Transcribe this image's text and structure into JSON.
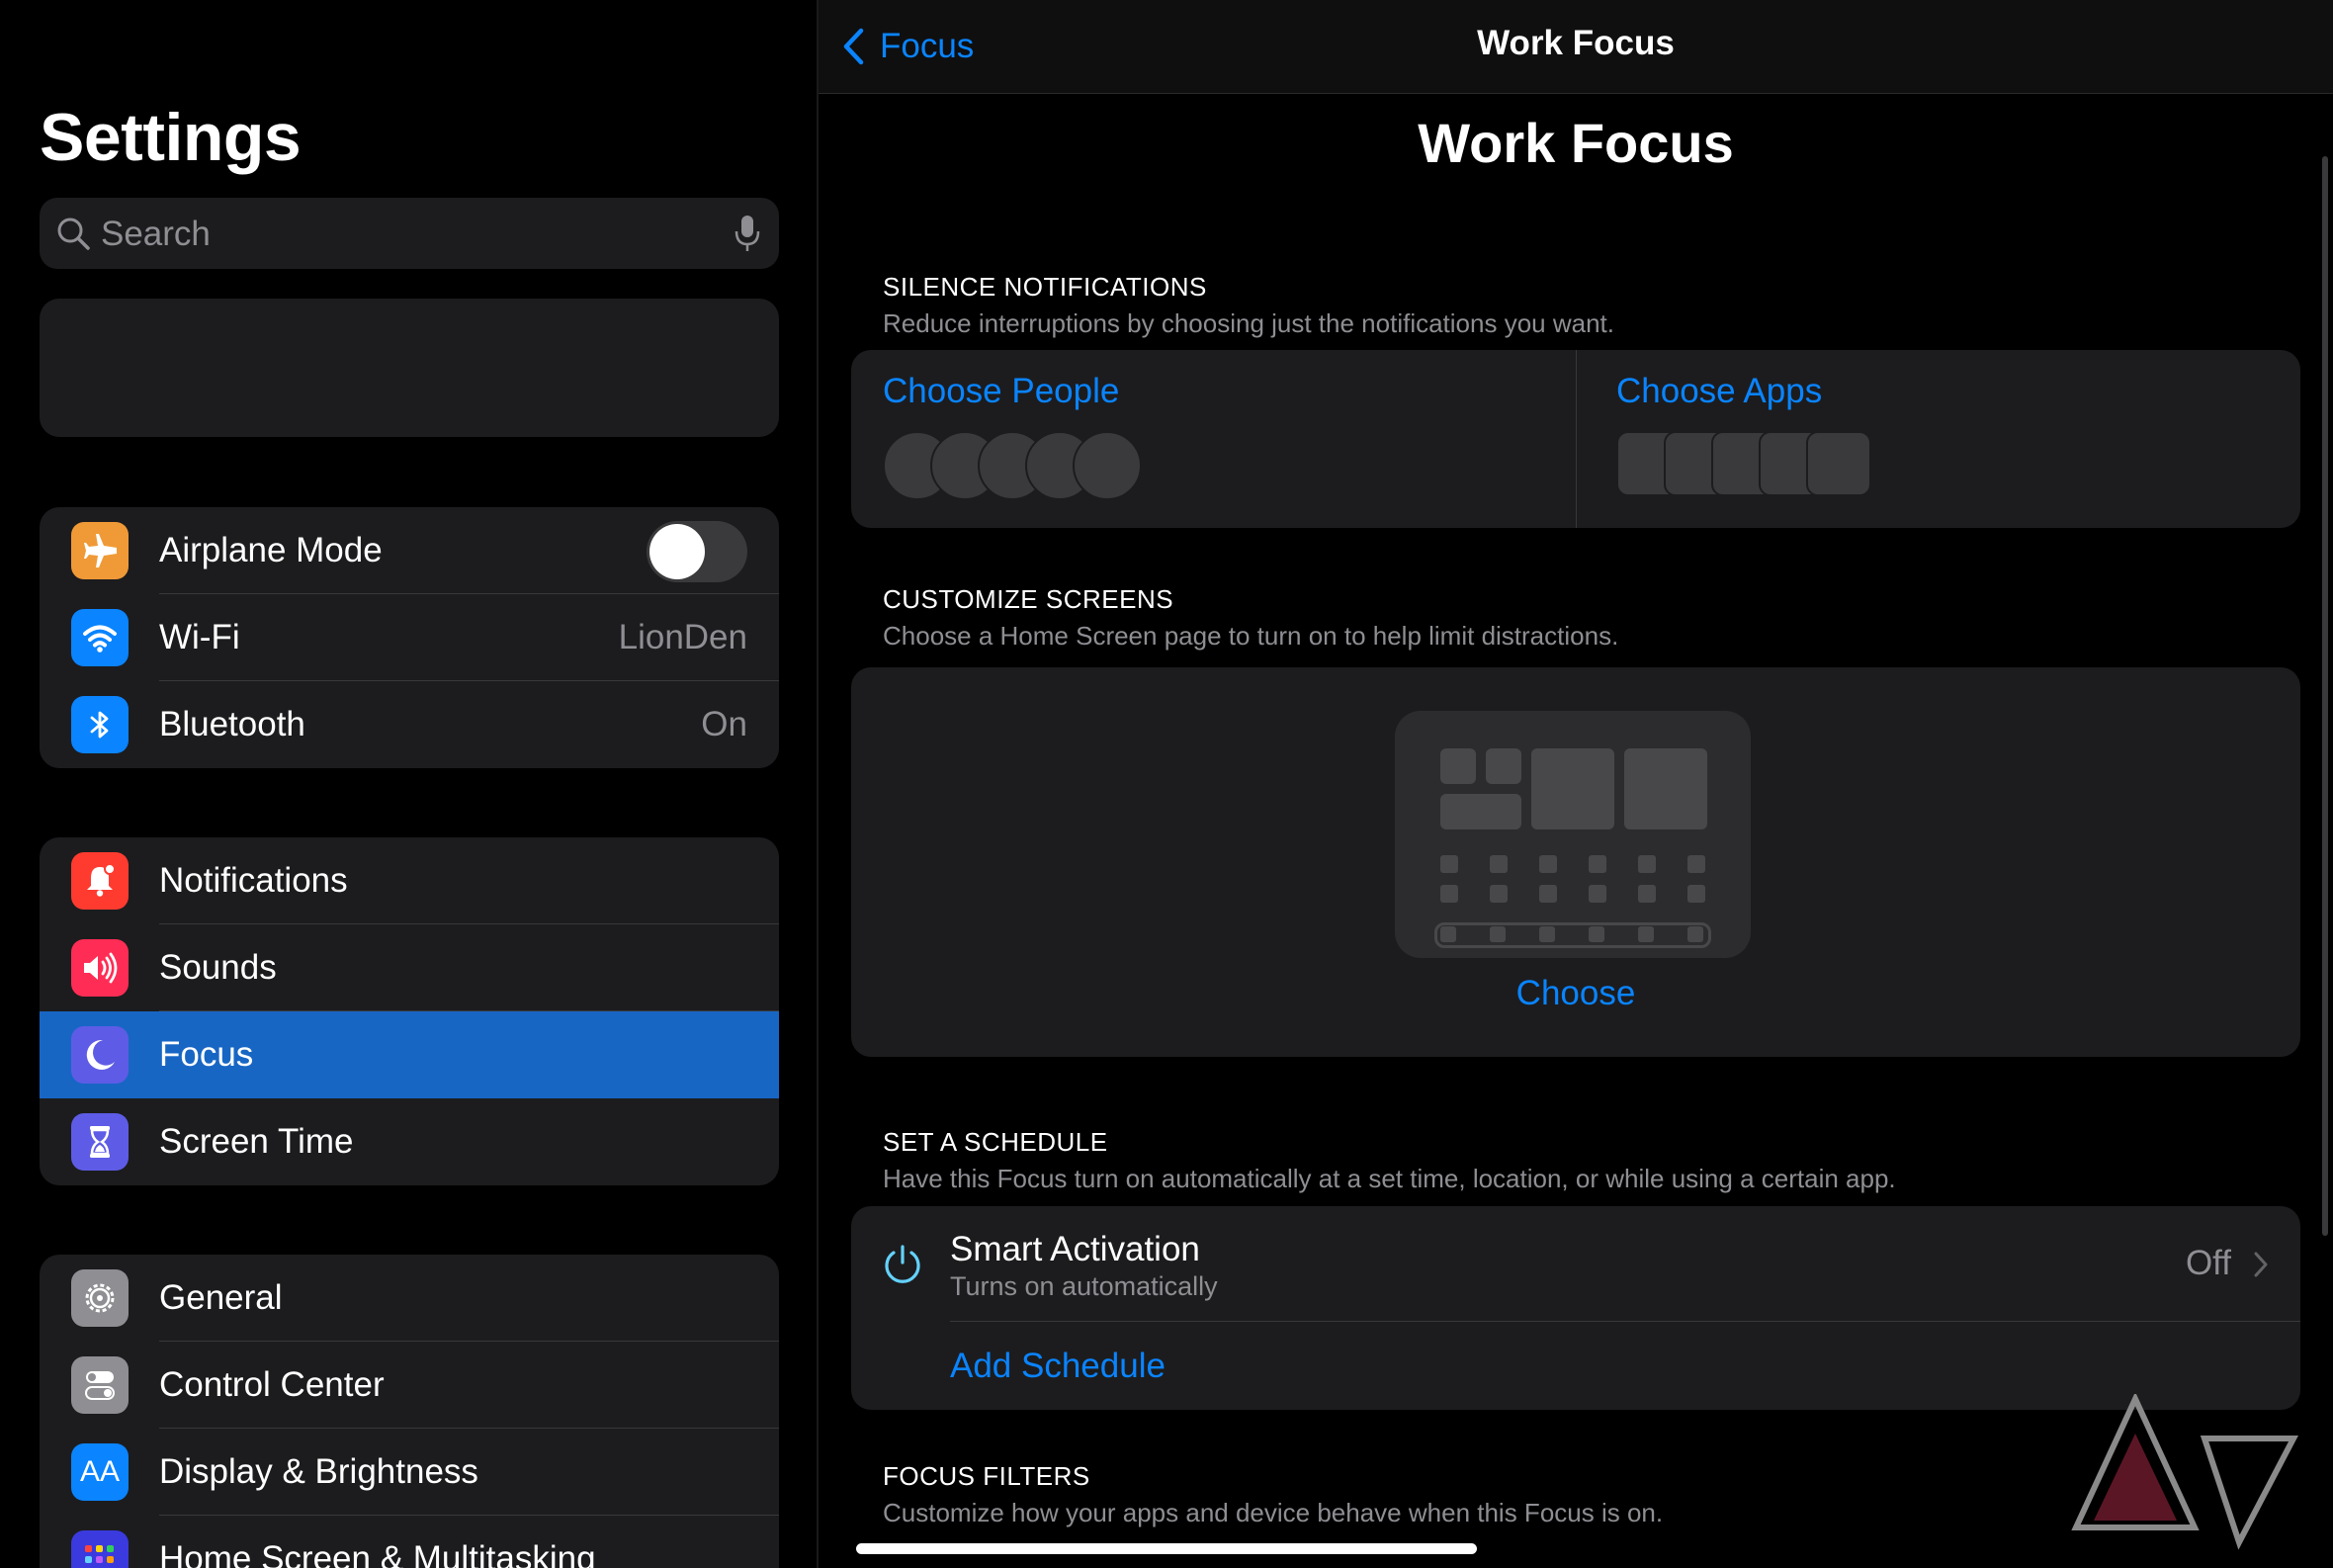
{
  "sidebar": {
    "title": "Settings",
    "search": {
      "placeholder": "Search",
      "icon": "magnifier-icon",
      "mic_icon": "mic-icon"
    },
    "groups": [
      {
        "items": [
          {
            "label": "Airplane Mode",
            "icon": "airplane-icon",
            "icon_color": "#f09a37",
            "toggle": false
          },
          {
            "label": "Wi-Fi",
            "icon": "wifi-icon",
            "icon_color": "#0a84ff",
            "value": "LionDen"
          },
          {
            "label": "Bluetooth",
            "icon": "bluetooth-icon",
            "icon_color": "#0a84ff",
            "value": "On"
          }
        ]
      },
      {
        "items": [
          {
            "label": "Notifications",
            "icon": "bell-icon",
            "icon_color": "#ff3b30"
          },
          {
            "label": "Sounds",
            "icon": "speaker-icon",
            "icon_color": "#ff2d55"
          },
          {
            "label": "Focus",
            "icon": "moon-icon",
            "icon_color": "#5e5ce6",
            "selected": true
          },
          {
            "label": "Screen Time",
            "icon": "hourglass-icon",
            "icon_color": "#5e5ce6"
          }
        ]
      },
      {
        "items": [
          {
            "label": "General",
            "icon": "gear-icon",
            "icon_color": "#8e8e93"
          },
          {
            "label": "Control Center",
            "icon": "switches-icon",
            "icon_color": "#8e8e93"
          },
          {
            "label": "Display & Brightness",
            "icon": "text-size-icon",
            "icon_color": "#0a84ff",
            "icon_text": "AA"
          },
          {
            "label": "Home Screen & Multitasking",
            "icon": "app-grid-icon",
            "icon_color": "#3a3adf"
          }
        ]
      }
    ]
  },
  "detail": {
    "back_label": "Focus",
    "nav_title": "Work Focus",
    "title": "Work Focus",
    "silence": {
      "header": "SILENCE NOTIFICATIONS",
      "subtitle": "Reduce interruptions by choosing just the notifications you want.",
      "people_label": "Choose People",
      "apps_label": "Choose Apps"
    },
    "customize": {
      "header": "CUSTOMIZE SCREENS",
      "subtitle": "Choose a Home Screen page to turn on to help limit distractions.",
      "choose_label": "Choose"
    },
    "schedule": {
      "header": "SET A SCHEDULE",
      "subtitle": "Have this Focus turn on automatically at a set time, location, or while using a certain app.",
      "smart_title": "Smart Activation",
      "smart_subtitle": "Turns on automatically",
      "smart_value": "Off",
      "add_label": "Add Schedule"
    },
    "filters": {
      "header": "FOCUS FILTERS",
      "subtitle": "Customize how your apps and device behave when this Focus is on."
    }
  },
  "colors": {
    "accent": "#0a84ff",
    "selection": "#1866c4",
    "card": "#1c1c1e",
    "background": "#000000"
  }
}
